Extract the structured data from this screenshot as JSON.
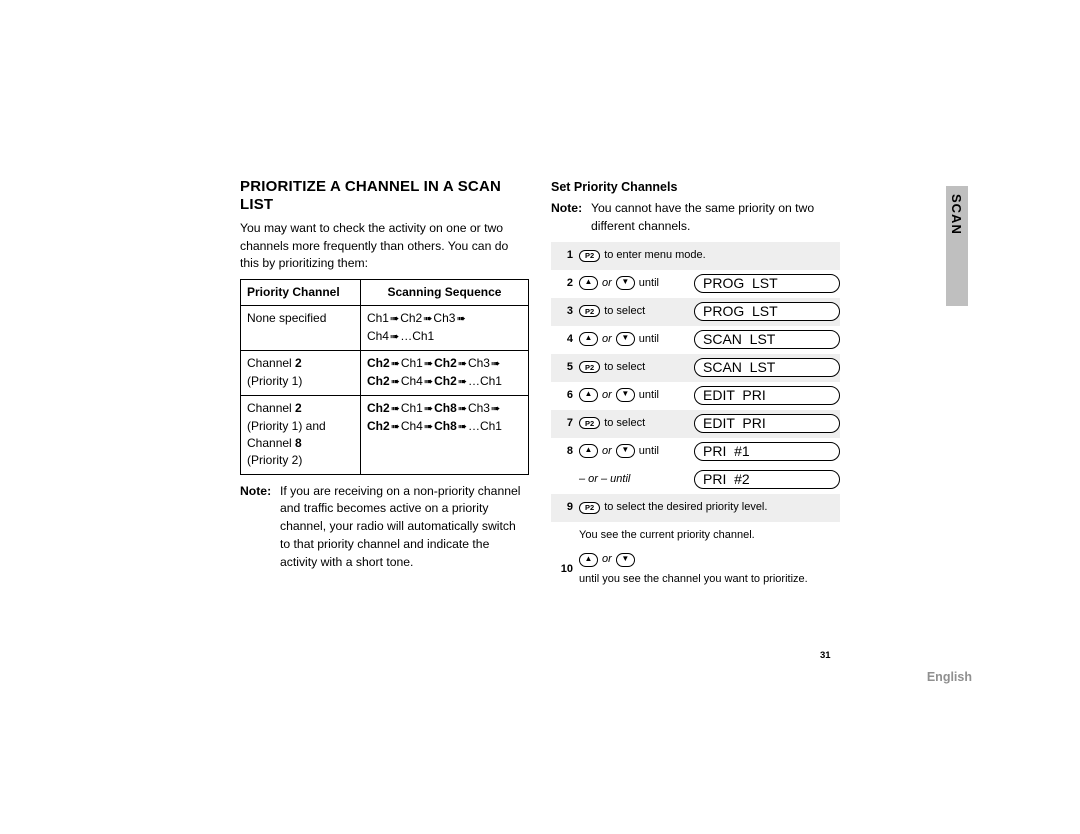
{
  "sidebar": {
    "vertical_label": "SCAN",
    "language": "English"
  },
  "page_number": "31",
  "left": {
    "title": "PRIORITIZE A CHANNEL IN A SCAN LIST",
    "intro": "You may want to check the activity on one or two channels more frequently than others. You can do this by prioritizing them:",
    "table": {
      "head1": "Priority Channel",
      "head2": "Scanning Sequence",
      "rows": [
        {
          "c1": "None specified",
          "c2_parts": [
            "Ch1",
            "Ch2",
            "Ch3",
            "Ch4",
            "…Ch1"
          ]
        },
        {
          "c1_html": "Channel <b>2</b> (Priority 1)",
          "c2_bold_idx": 0,
          "c2_parts_a": [
            "Ch2",
            "Ch1",
            "Ch2",
            "Ch3"
          ],
          "c2_parts_b": [
            "Ch2",
            "Ch4",
            "Ch2",
            "…Ch1"
          ]
        },
        {
          "c1_html": "Channel <b>2</b> (Priority 1) and Channel <b>8</b> (Priority 2)",
          "c2_parts_a": [
            "Ch2",
            "Ch1",
            "Ch8",
            "Ch3"
          ],
          "c2_parts_b": [
            "Ch2",
            "Ch4",
            "Ch8",
            "…Ch1"
          ]
        }
      ]
    },
    "note_label": "Note:",
    "note": "If you are receiving on a non-priority channel and traffic becomes active on a priority channel, your radio will automatically switch to that priority channel and indicate the activity with a short tone."
  },
  "right": {
    "subtitle": "Set Priority Channels",
    "note_label": "Note:",
    "note": "You cannot have the same priority on two different channels.",
    "p2_label": "P2",
    "txt": {
      "to_enter": "to enter menu mode.",
      "or": "or",
      "until": "until",
      "to_select": "to select",
      "or_dash": "– or – until",
      "select_priority": "to select the desired priority level.",
      "you_see": "You see the current priority channel.",
      "step10": "until you see the channel you want to prioritize."
    },
    "lcd": {
      "prog_lst": "PROG  LST",
      "scan_lst": "SCAN  LST",
      "edit_pri": "EDIT  PRI",
      "pri_1": "PRI  #1",
      "pri_2": "PRI  #2"
    }
  }
}
